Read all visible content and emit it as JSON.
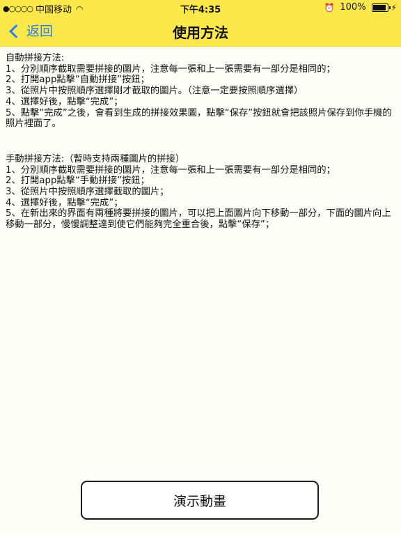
{
  "status": {
    "carrier": "中国移动",
    "time": "下午4:35",
    "battery": "100%",
    "battery_level": 1.0
  },
  "nav": {
    "back_label": "返回",
    "title": "使用方法"
  },
  "auto": {
    "title": "自動拼接方法:",
    "lines": [
      "1、分別順序截取需要拼接的圖片，注意每一張和上一張需要有一部分是相同的；",
      "2、打開app點擊“自動拼接”按鈕；",
      "3、從照片中按照順序選擇剛才截取的圖片。（注意一定要按照順序選擇）",
      "4、選擇好後，點擊“完成”；",
      "5、點擊“完成”之後，會看到生成的拼接效果圖，點擊“保存”按鈕就會把該照片保存到你手機的照片裡面了。"
    ]
  },
  "manual": {
    "title": "手動拼接方法:（暫時支持兩種圖片的拼接）",
    "lines": [
      "1、分別順序截取需要拼接的圖片，注意每一張和上一張需要有一部分是相同的；",
      "2、打開app點擊“手動拼接”按鈕；",
      "3、從照片中按照順序選擇截取的圖片；",
      "4、選擇好後，點擊“完成”；",
      "5、在新出來的界面有兩種將要拼接的圖片，可以把上面圖片向下移動一部分，下面的圖片向上移動一部分，慢慢調整達到使它們能夠完全重合後，點擊“保存”；"
    ]
  },
  "demo_button_label": "演示動畫"
}
